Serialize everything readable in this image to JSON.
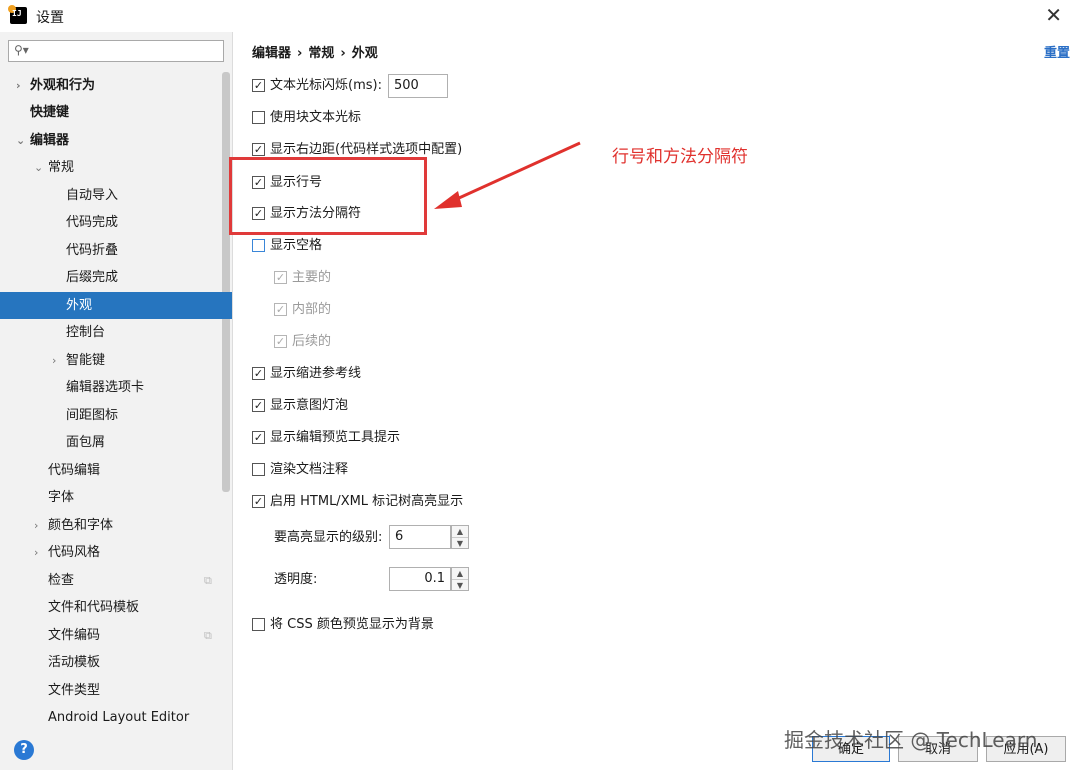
{
  "window": {
    "title": "设置",
    "close": "✕"
  },
  "search": {
    "placeholder": ""
  },
  "tree": [
    {
      "label": "外观和行为"
    },
    {
      "label": "快捷键"
    },
    {
      "label": "编辑器"
    },
    {
      "label": "常规"
    },
    {
      "label": "自动导入"
    },
    {
      "label": "代码完成"
    },
    {
      "label": "代码折叠"
    },
    {
      "label": "后缀完成"
    },
    {
      "label": "外观"
    },
    {
      "label": "控制台"
    },
    {
      "label": "智能键"
    },
    {
      "label": "编辑器选项卡"
    },
    {
      "label": "间距图标"
    },
    {
      "label": "面包屑"
    },
    {
      "label": "代码编辑"
    },
    {
      "label": "字体"
    },
    {
      "label": "颜色和字体"
    },
    {
      "label": "代码风格"
    },
    {
      "label": "检查"
    },
    {
      "label": "文件和代码模板"
    },
    {
      "label": "文件编码"
    },
    {
      "label": "活动模板"
    },
    {
      "label": "文件类型"
    },
    {
      "label": "Android Layout Editor"
    }
  ],
  "breadcrumb": {
    "a": "编辑器",
    "sep1": "›",
    "b": "常规",
    "sep2": "›",
    "c": "外观"
  },
  "reset_label": "重置",
  "options": {
    "caret_blink": "文本光标闪烁(ms):",
    "caret_blink_value": "500",
    "block_caret": "使用块文本光标",
    "right_margin": "显示右边距(代码样式选项中配置)",
    "line_numbers": "显示行号",
    "method_separators": "显示方法分隔符",
    "whitespace": "显示空格",
    "leading": "主要的",
    "inner": "内部的",
    "trailing": "后续的",
    "indent_guides": "显示缩进参考线",
    "intention_bulb": "显示意图灯泡",
    "preview_tooltip": "显示编辑预览工具提示",
    "render_docs": "渲染文档注释",
    "html_xml": "启用 HTML/XML 标记树高亮显示",
    "highlight_level_label": "要高亮显示的级别:",
    "highlight_level_value": "6",
    "opacity_label": "透明度:",
    "opacity_value": "0.1",
    "css_color": "将 CSS 颜色预览显示为背景"
  },
  "annotation": "行号和方法分隔符",
  "buttons": {
    "ok": "确定",
    "cancel": "取消",
    "apply": "应用(A)"
  },
  "watermark": "掘金技术社区 @ TechLearn",
  "colors": {
    "selected": "#2675bf",
    "link": "#2b6fc6",
    "annotation": "#e0312d"
  }
}
